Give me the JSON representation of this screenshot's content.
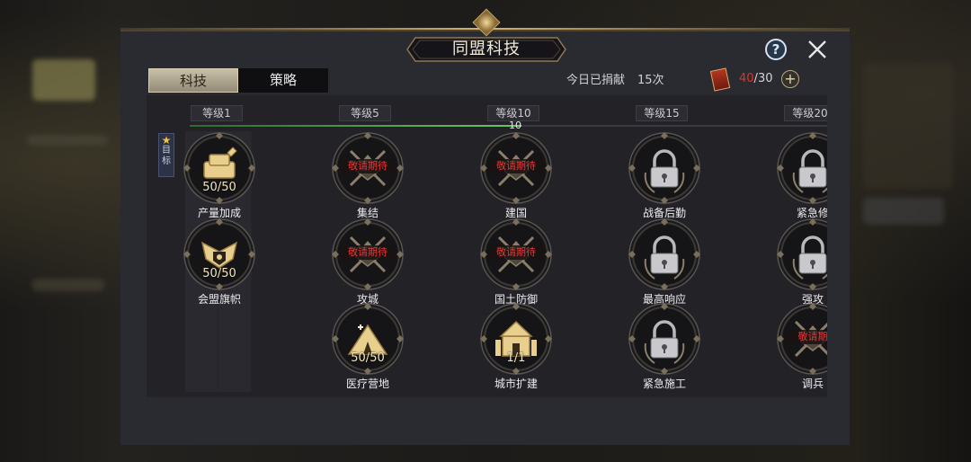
{
  "header": {
    "title": "同盟科技"
  },
  "tabs": [
    {
      "label": "科技",
      "active": true
    },
    {
      "label": "策略",
      "active": false
    }
  ],
  "donation": {
    "label": "今日已捐献",
    "value": "15次"
  },
  "points": {
    "current": "40",
    "separator": "/",
    "max": "30"
  },
  "tiers": [
    "等级1",
    "等级5",
    "等级10",
    "等级15",
    "等级20"
  ],
  "progress": {
    "value_label": "10",
    "fraction": 0.52
  },
  "goal_tag": {
    "text": "目标"
  },
  "nodes": [
    {
      "name": "产量加成",
      "status": "owned",
      "count": "50/50",
      "icon": "supplies-icon"
    },
    {
      "name": "会盟旗帜",
      "status": "owned",
      "count": "50/50",
      "icon": "eagle-banner-icon"
    },
    {
      "name": "集结",
      "status": "coming-soon",
      "banner": "敬请期待",
      "icon": "crossed-swords-icon"
    },
    {
      "name": "攻城",
      "status": "coming-soon",
      "banner": "敬请期待",
      "icon": "castle-emblem-icon"
    },
    {
      "name": "医疗营地",
      "status": "owned",
      "count": "50/50",
      "icon": "tent-icon"
    },
    {
      "name": "建国",
      "status": "coming-soon",
      "banner": "敬请期待",
      "icon": "crown-emblem-icon"
    },
    {
      "name": "国土防御",
      "status": "coming-soon",
      "banner": "敬请期待",
      "icon": "shield-emblem-icon"
    },
    {
      "name": "城市扩建",
      "status": "owned",
      "count": "1/1",
      "icon": "city-icon"
    },
    {
      "name": "战备后勤",
      "status": "locked",
      "icon": "padlock-icon"
    },
    {
      "name": "最高响应",
      "status": "locked",
      "icon": "padlock-icon"
    },
    {
      "name": "紧急施工",
      "status": "locked",
      "icon": "padlock-icon"
    },
    {
      "name": "紧急修",
      "status": "locked",
      "icon": "padlock-icon"
    },
    {
      "name": "强攻",
      "status": "locked",
      "icon": "padlock-icon"
    },
    {
      "name": "调兵",
      "status": "coming-soon",
      "banner": "敬请期",
      "icon": "troops-icon"
    }
  ],
  "colors": {
    "accent_gold": "#c8a86a",
    "coming_soon_red": "#e0373a",
    "progress_green": "#6cc66a",
    "panel_bg": "#2a2a31"
  }
}
